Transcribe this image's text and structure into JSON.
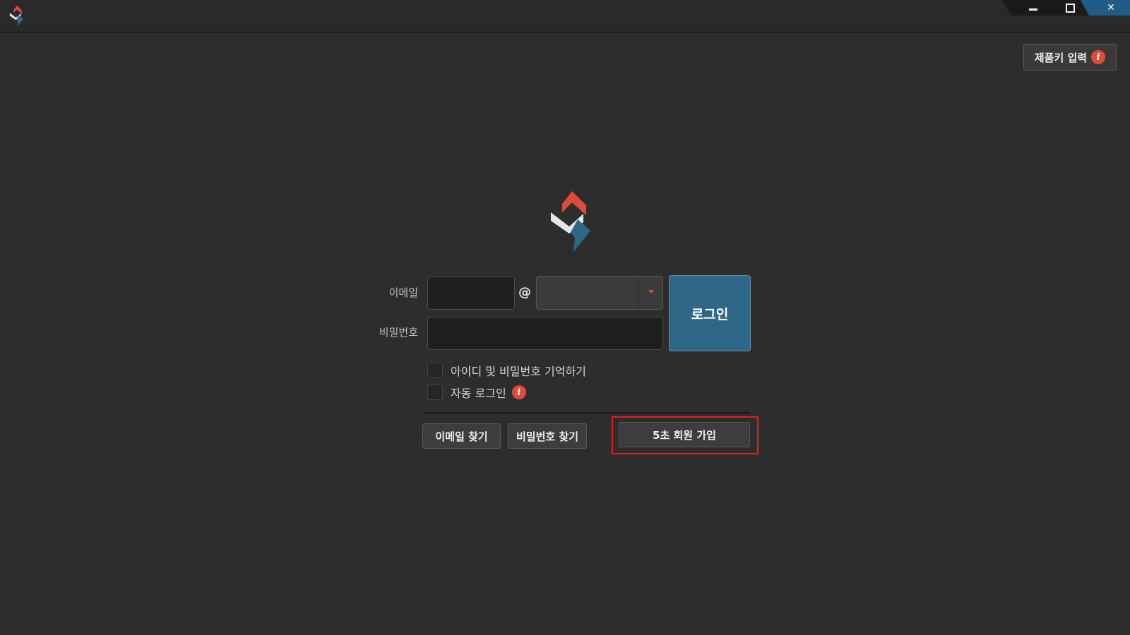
{
  "window": {
    "controls": {
      "minimize_icon": "minimize-icon",
      "maximize_icon": "maximize-icon",
      "close_glyph": "✕"
    },
    "accent_color": "#e04a3a",
    "titlebar_color": "#2a2a2a",
    "controls_color": "#1f5d86"
  },
  "header": {
    "product_key_label": "제품키 입력",
    "info_glyph": "i"
  },
  "login_form": {
    "email_label": "이메일",
    "email_local_value": "",
    "at_symbol": "@",
    "email_domain_value": "",
    "password_label": "비밀번호",
    "password_value": "",
    "login_button_label": "로그인",
    "login_button_color": "#2f6788",
    "remember_label": "아이디 및 비밀번호 기억하기",
    "remember_checked": false,
    "auto_login_label": "자동 로그인",
    "auto_login_checked": false,
    "auto_login_info_glyph": "i"
  },
  "footer_actions": {
    "find_email_label": "이메일 찾기",
    "find_password_label": "비밀번호 찾기",
    "signup_label": "5초 회원 가입",
    "signup_highlight_color": "#e01f1f"
  }
}
